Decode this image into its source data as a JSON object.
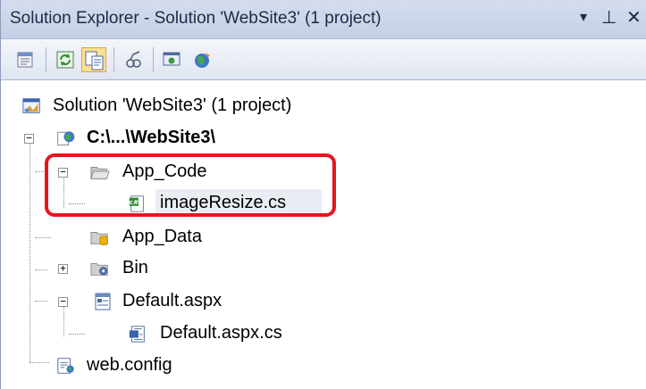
{
  "window": {
    "title": "Solution Explorer - Solution 'WebSite3' (1 project)",
    "pin_glyph": "▾",
    "autohide_glyph": "⊥",
    "close_glyph": "✕"
  },
  "toolbar": {
    "buttons": [
      {
        "name": "properties",
        "icon": "properties-icon"
      },
      {
        "name": "refresh",
        "icon": "refresh-icon"
      },
      {
        "name": "nest-related-files",
        "icon": "nest-related-files-icon",
        "pressed": true
      },
      {
        "name": "view-designer",
        "icon": "view-designer-icon"
      },
      {
        "name": "web-configuration",
        "icon": "web-configuration-icon"
      },
      {
        "name": "copy-web-site",
        "icon": "copy-website-icon"
      }
    ]
  },
  "tree": {
    "solution": "Solution 'WebSite3' (1 project)",
    "project": "C:\\...\\WebSite3\\",
    "app_code": "App_Code",
    "image_resize": "imageResize.cs",
    "app_data": "App_Data",
    "bin": "Bin",
    "default_aspx": "Default.aspx",
    "default_aspx_cs": "Default.aspx.cs",
    "web_config": "web.config",
    "expander_minus": "−",
    "expander_plus": "+"
  },
  "colors": {
    "highlight": "#e8141e",
    "titlebar": "#c9d3e8",
    "selected": "#e9ecf2"
  }
}
